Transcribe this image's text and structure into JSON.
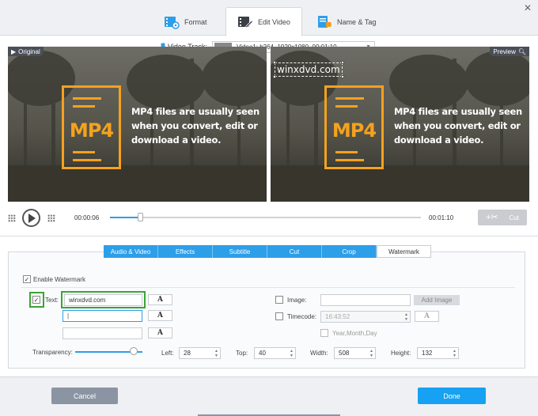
{
  "tabs": [
    {
      "label": "Format",
      "icon": "film-settings-icon"
    },
    {
      "label": "Edit Video",
      "icon": "film-edit-icon"
    },
    {
      "label": "Name & Tag",
      "icon": "tag-document-icon"
    }
  ],
  "video_track": {
    "label": "Video Track:",
    "value": "Video1: h264, 1920x1080, 00:01:10"
  },
  "panes": {
    "original_label": "Original",
    "preview_label": "Preview",
    "mp4_text": "MP4",
    "caption": "MP4 files are usually seen when you convert, edit or download a video.",
    "watermark_text": "winxdvd.com"
  },
  "player": {
    "current_time": "00:00:06",
    "end_time": "00:01:10",
    "progress": 0.097,
    "cut_label": "Cut"
  },
  "edit_tabs": [
    "Audio & Video",
    "Effects",
    "Subtitle",
    "Cut",
    "Crop",
    "Watermark"
  ],
  "watermark": {
    "enable_label": "Enable Watermark",
    "text_label": "Text:",
    "text_value": "winxdvd.com",
    "text_line2": "",
    "text_line3": "",
    "font_glyph": "A",
    "image_label": "Image:",
    "image_value": "",
    "add_image_label": "Add Image",
    "timecode_label": "Timecode:",
    "timecode_value": "16:43:52",
    "date_label": "Year,Month,Day",
    "transparency_label": "Transparency:",
    "transparency": 0.85,
    "left_label": "Left:",
    "left_value": "28",
    "top_label": "Top:",
    "top_value": "40",
    "width_label": "Width:",
    "width_value": "508",
    "height_label": "Height:",
    "height_value": "132"
  },
  "footer": {
    "cancel_label": "Cancel",
    "done_label": "Done"
  },
  "colors": {
    "accent": "#2d9ee8",
    "done": "#16a1f2",
    "highlight": "#3aa535",
    "mp4_orange": "#f4a21e"
  }
}
